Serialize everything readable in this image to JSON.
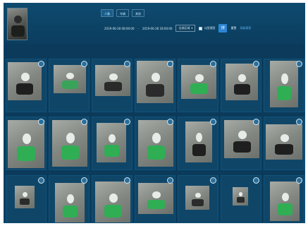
{
  "header": {
    "tabs": [
      {
        "label": "人像",
        "active": true
      },
      {
        "label": "车辆",
        "active": false
      },
      {
        "label": "其他",
        "active": false
      }
    ],
    "start_time": "2019-06-28 08:00:00",
    "time_separator": "-",
    "end_time": "2019-06-28 18:00:00",
    "select_value": "全部区域",
    "checkbox_label": "以图搜图",
    "search_label": "搜",
    "reset_label": "重置",
    "advanced_label": "高级搜索"
  },
  "colors": {
    "frame_bg": "#0b3a5a",
    "card_bg": "#0f4668",
    "accent": "#2d86d4",
    "vehicle_green": "#2fae54"
  },
  "results": {
    "rows": [
      [
        {
          "bike_color": "#1f1f1f",
          "badge": "similarity-badge"
        },
        {
          "bike_color": "#3aa35a",
          "badge": "similarity-badge"
        },
        {
          "bike_color": "#2a2a2a",
          "badge": "similarity-badge"
        },
        {
          "bike_color": "#2b2b2b",
          "badge": "similarity-badge"
        },
        {
          "bike_color": "#2fae54",
          "badge": "similarity-badge"
        },
        {
          "bike_color": "#1f1f1f",
          "badge": "similarity-badge"
        },
        {
          "bike_color": "#2fae54",
          "badge": "similarity-badge"
        }
      ],
      [
        {
          "bike_color": "#2fae54",
          "badge": "similarity-badge"
        },
        {
          "bike_color": "#2fae54",
          "badge": "similarity-badge"
        },
        {
          "bike_color": "#2fae54",
          "badge": "similarity-badge"
        },
        {
          "bike_color": "#2fae54",
          "badge": "similarity-badge"
        },
        {
          "bike_color": "#1f1f1f",
          "badge": "similarity-badge"
        },
        {
          "bike_color": "#1f1f1f",
          "badge": "similarity-badge"
        },
        {
          "bike_color": "#1f1f1f",
          "badge": "similarity-badge"
        }
      ],
      [
        {
          "bike_color": "#2b2b2b",
          "badge": "similarity-badge"
        },
        {
          "bike_color": "#2fae54",
          "badge": "similarity-badge"
        },
        {
          "bike_color": "#2fae54",
          "badge": "similarity-badge"
        },
        {
          "bike_color": "#2fae54",
          "badge": "similarity-badge"
        },
        {
          "bike_color": "#2b2b2b",
          "badge": "similarity-badge"
        },
        {
          "bike_color": "#2b2b2b",
          "badge": "similarity-badge"
        },
        {
          "bike_color": "#2fae54",
          "badge": "similarity-badge"
        }
      ]
    ]
  }
}
